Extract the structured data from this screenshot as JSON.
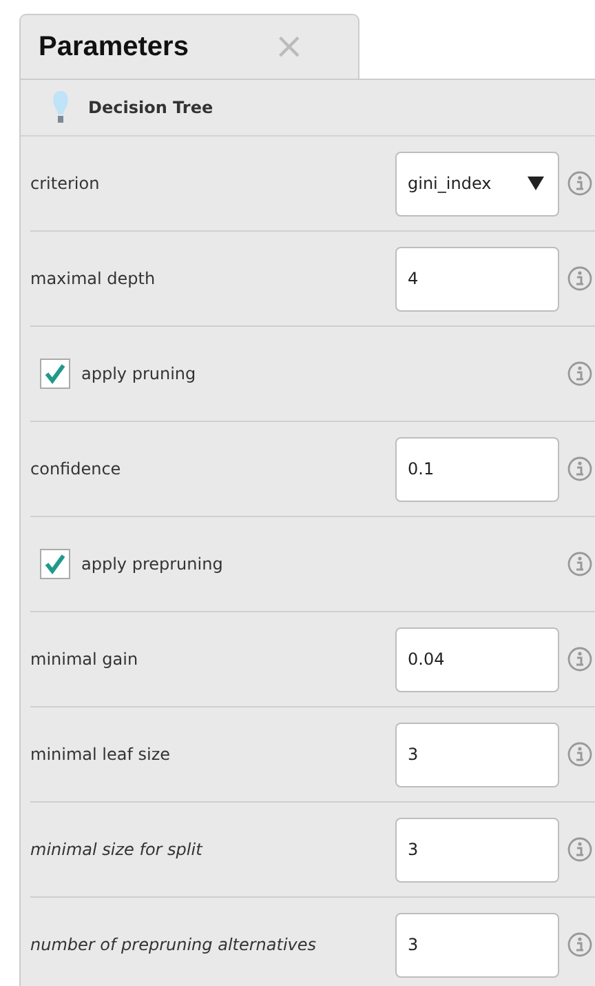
{
  "tab": {
    "title": "Parameters",
    "close": "×"
  },
  "operator": {
    "name": "Decision Tree"
  },
  "parameters": [
    {
      "kind": "select",
      "label": "criterion",
      "value": "gini_index",
      "expert": false
    },
    {
      "kind": "number",
      "label": "maximal depth",
      "value": "4",
      "expert": false
    },
    {
      "kind": "checkbox",
      "label": "apply pruning",
      "checked": true
    },
    {
      "kind": "number",
      "label": "confidence",
      "value": "0.1",
      "expert": false
    },
    {
      "kind": "checkbox",
      "label": "apply prepruning",
      "checked": true
    },
    {
      "kind": "number",
      "label": "minimal gain",
      "value": "0.04",
      "expert": false
    },
    {
      "kind": "number",
      "label": "minimal leaf size",
      "value": "3",
      "expert": false
    },
    {
      "kind": "number",
      "label": "minimal size for split",
      "value": "3",
      "expert": true
    },
    {
      "kind": "number",
      "label": "number of prepruning alternatives",
      "value": "3",
      "expert": true
    }
  ]
}
